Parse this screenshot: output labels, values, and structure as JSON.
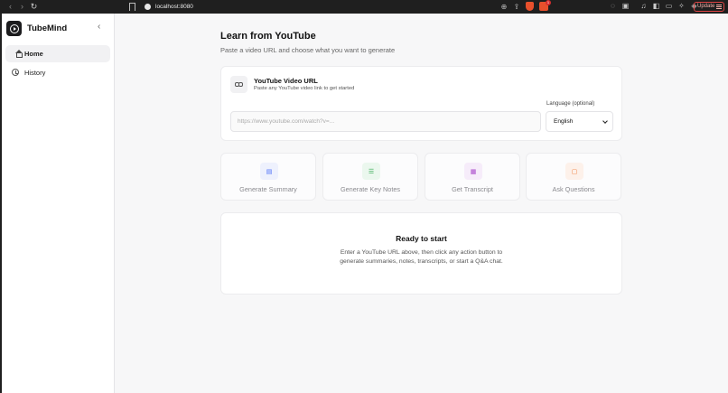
{
  "browser": {
    "url": "localhost:8080",
    "update_label": "Update",
    "rewards_badge": "1"
  },
  "sidebar": {
    "brand": "TubeMind",
    "items": [
      {
        "label": "Home",
        "icon": "home-icon",
        "active": true
      },
      {
        "label": "History",
        "icon": "history-icon",
        "active": false
      }
    ]
  },
  "main": {
    "title": "Learn from YouTube",
    "subtitle": "Paste a video URL and choose what you want to generate",
    "url_card": {
      "title": "YouTube Video URL",
      "subtitle": "Paste any YouTube video link to get started",
      "input_placeholder": "https://www.youtube.com/watch?v=...",
      "input_value": "",
      "language_label": "Language (optional)",
      "language_value": "English"
    },
    "actions": [
      {
        "label": "Generate Summary",
        "icon": "document-icon",
        "color": "#4a6cf7",
        "bg": "#eef1fd"
      },
      {
        "label": "Generate Key Notes",
        "icon": "list-icon",
        "color": "#2fa84f",
        "bg": "#ebf7ee"
      },
      {
        "label": "Get Transcript",
        "icon": "transcript-icon",
        "color": "#a845c9",
        "bg": "#f6ecfa"
      },
      {
        "label": "Ask Questions",
        "icon": "chat-icon",
        "color": "#f07b3a",
        "bg": "#fdf1ea"
      }
    ],
    "status": {
      "title": "Ready to start",
      "body": "Enter a YouTube URL above, then click any action button to generate summaries, notes, transcripts, or start a Q&A chat."
    }
  }
}
